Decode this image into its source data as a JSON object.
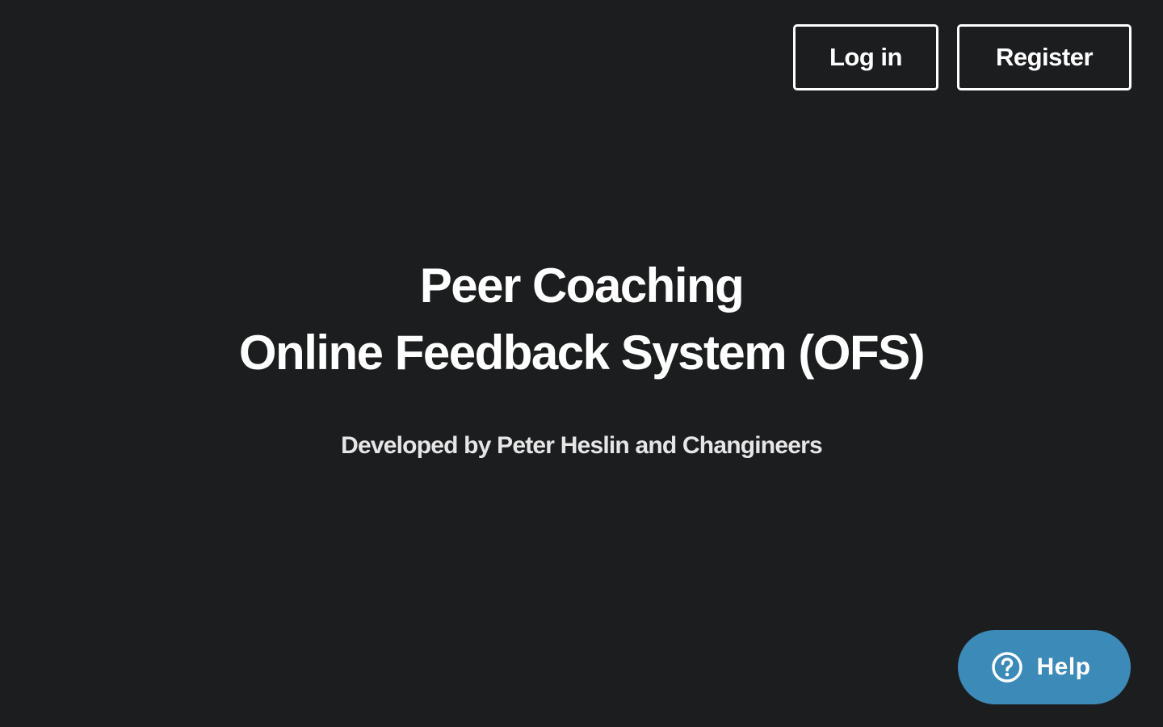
{
  "header": {
    "login_label": "Log in",
    "register_label": "Register"
  },
  "hero": {
    "title_line1": "Peer Coaching",
    "title_line2": "Online Feedback System (OFS)",
    "subtitle": "Developed by Peter Heslin and Changineers"
  },
  "help_widget": {
    "label": "Help",
    "icon": "question-circle-icon"
  },
  "colors": {
    "background": "#1c1d1f",
    "text": "#ffffff",
    "help_button": "#3b8ab8"
  }
}
